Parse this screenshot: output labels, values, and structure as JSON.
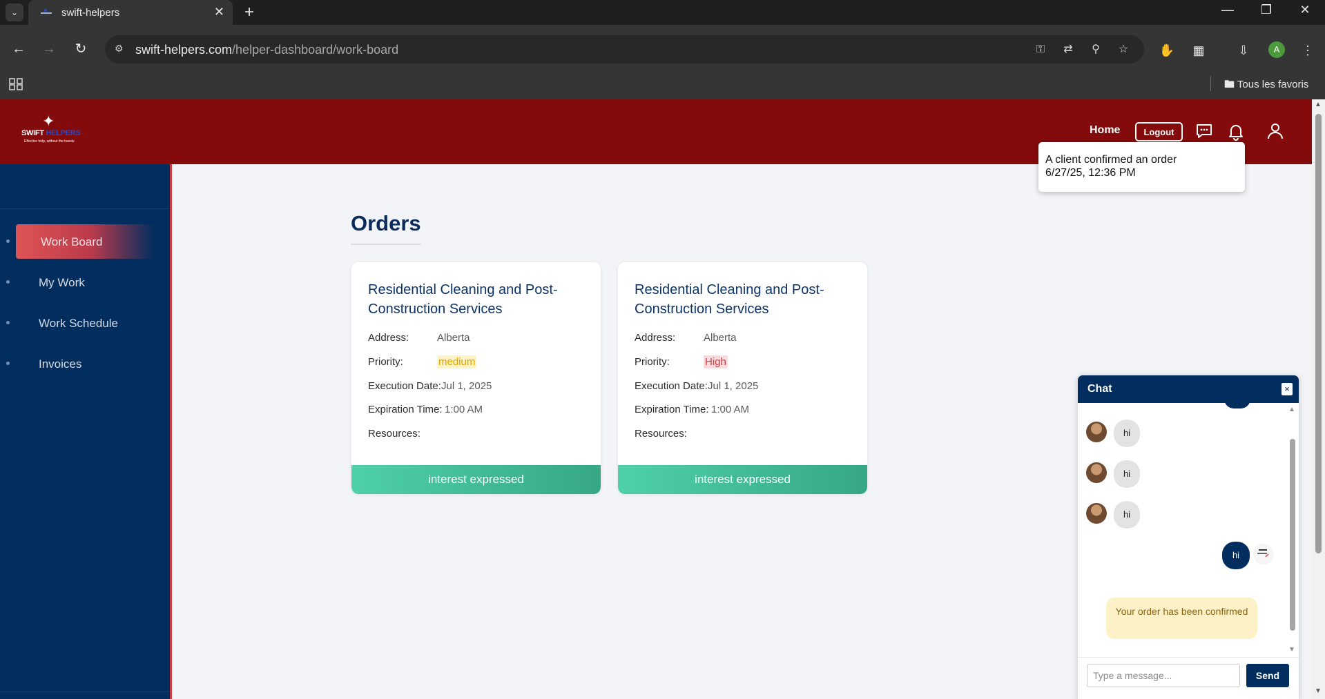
{
  "browser": {
    "tab_title": "swift-helpers",
    "url_host": "swift-helpers.com",
    "url_path": "/helper-dashboard/work-board",
    "bookmarks_folder": "Tous les favoris",
    "profile_initial": "A"
  },
  "header": {
    "logo_brand_1": "SWIFT",
    "logo_brand_2": "HELPERS",
    "logo_tagline": "Effective help, without the hassle",
    "home_label": "Home",
    "logout_label": "Logout"
  },
  "notification": {
    "message": "A client confirmed an order",
    "time": "6/27/25, 12:36 PM"
  },
  "sidebar": {
    "items": [
      {
        "label": "Work Board",
        "active": true
      },
      {
        "label": "My Work",
        "active": false
      },
      {
        "label": "Work Schedule",
        "active": false
      },
      {
        "label": "Invoices",
        "active": false
      }
    ]
  },
  "main": {
    "title": "Orders",
    "labels": {
      "address": "Address:",
      "priority": "Priority:",
      "execution_date": "Execution Date:",
      "expiration_time": "Expiration Time:",
      "resources": "Resources:"
    },
    "cards": [
      {
        "title": "Residential Cleaning and Post-Construction Services",
        "address": "Alberta",
        "priority": "medium",
        "execution_date": "Jul 1, 2025",
        "expiration_time": "1:00 AM",
        "resources": "",
        "action": "interest expressed"
      },
      {
        "title": "Residential Cleaning and Post-Construction Services",
        "address": "Alberta",
        "priority": "High",
        "execution_date": "Jul 1, 2025",
        "expiration_time": "1:00 AM",
        "resources": "",
        "action": "interest expressed"
      }
    ]
  },
  "chat": {
    "title": "Chat",
    "close": "×",
    "messages": [
      {
        "from": "other",
        "text": "hi"
      },
      {
        "from": "other",
        "text": "hi"
      },
      {
        "from": "other",
        "text": "hi"
      },
      {
        "from": "me",
        "text": "hi"
      }
    ],
    "system_message": "Your order has been confirmed",
    "input_placeholder": "Type a message...",
    "send_label": "Send"
  },
  "colors": {
    "header_bg": "#840b0b",
    "sidebar_bg": "#022d5f",
    "accent_green": "#3fb893",
    "title_navy": "#0a2b5c"
  }
}
